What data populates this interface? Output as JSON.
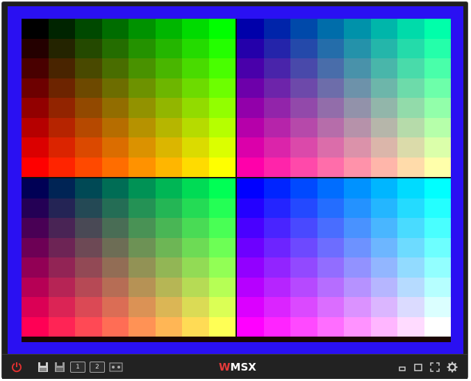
{
  "toolbar": {
    "logo_prefix": "W",
    "logo_main": "MSX",
    "drive_labels": [
      "1",
      "2"
    ],
    "icons": [
      "power-icon",
      "floppy-disk-icon",
      "floppy-disk-save-icon",
      "drive-1-icon",
      "drive-2-icon",
      "cassette-icon",
      "minimize-icon",
      "restore-window-icon",
      "fullscreen-icon",
      "settings-gear-icon"
    ]
  },
  "screen": {
    "border_color": "#2a10f2",
    "bottom_strip_color": "#1a0505",
    "quadrants": [
      {
        "r": "rows",
        "g": "cols",
        "b": 0
      },
      {
        "r": "rows",
        "g": "cols",
        "b": 2
      },
      {
        "r": "rows",
        "g": "cols",
        "b": 1
      },
      {
        "r": "rows",
        "g": "cols",
        "b": 3
      }
    ]
  }
}
